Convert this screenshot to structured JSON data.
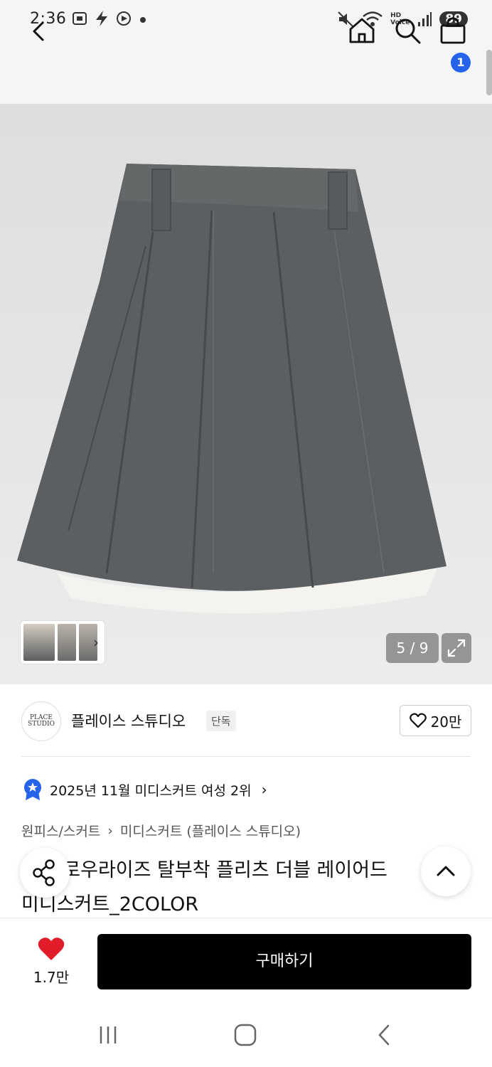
{
  "status_bar": {
    "time": "2:36",
    "battery": "89",
    "hd_label": "HD",
    "voice_label": "Voice"
  },
  "header": {
    "cart_count": "1"
  },
  "gallery": {
    "counter": "5 / 9"
  },
  "brand": {
    "logo_text": "PLACE\nSTUDIO",
    "name": "플레이스 스튜디오",
    "tag": "단독",
    "likes": "20만"
  },
  "ranking": {
    "text": "2025년 11월 미디스커트 여성 2위"
  },
  "breadcrumb": {
    "category": "원피스/스커트",
    "subcategory": "미디스커트 (플레이스 스튜디오)"
  },
  "product": {
    "title_line1": "투톤 로우라이즈 탈부착 플리츠 더블 레이어드",
    "title_line2": "미디스커트_2COLOR"
  },
  "bottom": {
    "wish_count": "1.7만",
    "buy_label": "구매하기"
  },
  "colors": {
    "accent": "#2563eb",
    "heart": "#e11d2a",
    "buy_bg": "#000000"
  }
}
